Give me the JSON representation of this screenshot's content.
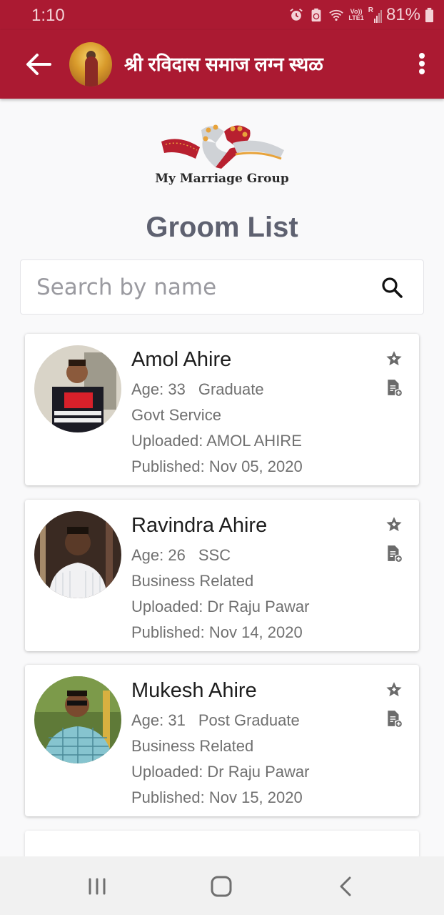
{
  "status_bar": {
    "time": "1:10",
    "icons": [
      "alarm-icon",
      "battery-saver-icon",
      "wifi-icon",
      "volte-lte-icon",
      "signal-icon"
    ],
    "volte_label": "Vo))",
    "lte_label": "LTE1",
    "roaming_label": "R",
    "battery": "81%"
  },
  "appbar": {
    "title": "श्री रविदास समाज लग्न स्थळ",
    "back_icon": "arrow-left-icon",
    "menu_icon": "more-vertical-icon"
  },
  "logo": {
    "text": "My Marriage Group",
    "colors": {
      "red": "#b8202f",
      "gold": "#e8a33a",
      "silver": "#cfd2d6"
    }
  },
  "page": {
    "title": "Groom List"
  },
  "search": {
    "placeholder": "Search by name",
    "value": "",
    "icon": "search-icon"
  },
  "grooms": [
    {
      "name": "Amol Ahire",
      "age": "Age: 33",
      "education": "Graduate",
      "occupation": "Govt Service",
      "uploaded": "Uploaded: AMOL AHIRE",
      "published": "Published: Nov 05, 2020"
    },
    {
      "name": "Ravindra Ahire",
      "age": "Age: 26",
      "education": "SSC",
      "occupation": "Business Related",
      "uploaded": "Uploaded: Dr Raju Pawar",
      "published": "Published: Nov 14, 2020"
    },
    {
      "name": "Mukesh Ahire",
      "age": "Age: 31",
      "education": "Post Graduate",
      "occupation": "Business Related",
      "uploaded": "Uploaded: Dr Raju Pawar",
      "published": "Published: Nov 15, 2020"
    }
  ],
  "colors": {
    "primary": "#ab1a32",
    "title_gray": "#5e6170",
    "meta_gray": "#707070",
    "icon_gray": "#6b6b6b"
  },
  "navbar": {
    "recents_icon": "recent-apps-icon",
    "home_icon": "home-icon",
    "back_icon": "back-icon"
  }
}
